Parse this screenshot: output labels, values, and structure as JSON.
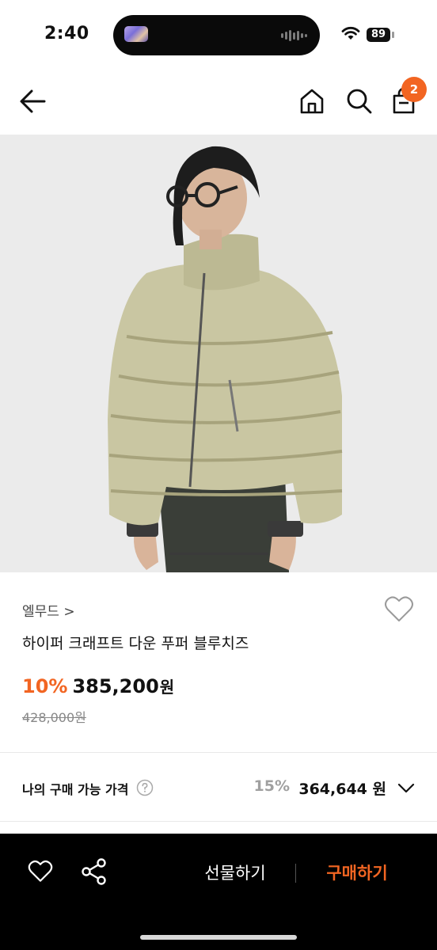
{
  "status": {
    "time": "2:40",
    "battery": "89"
  },
  "nav": {
    "cart_count": "2"
  },
  "product": {
    "brand": "엘무드 >",
    "name": "하이퍼 크래프트 다운 푸퍼 블루치즈",
    "discount": "10%",
    "price": "385,200",
    "price_unit": "원",
    "original_price": "428,000원"
  },
  "my_price": {
    "label": "나의 구매 가능 가격",
    "discount": "15%",
    "price": "364,644 원"
  },
  "bottom_bar": {
    "gift_label": "선물하기",
    "buy_label": "구매하기"
  },
  "colors": {
    "accent": "#f26522",
    "bar_bg": "#000000",
    "image_bg": "#e9e9e9"
  },
  "icons": [
    "back-arrow-icon",
    "home-icon",
    "search-icon",
    "shopping-bag-icon",
    "heart-icon",
    "help-circle-icon",
    "chevron-down-icon",
    "share-icon"
  ]
}
